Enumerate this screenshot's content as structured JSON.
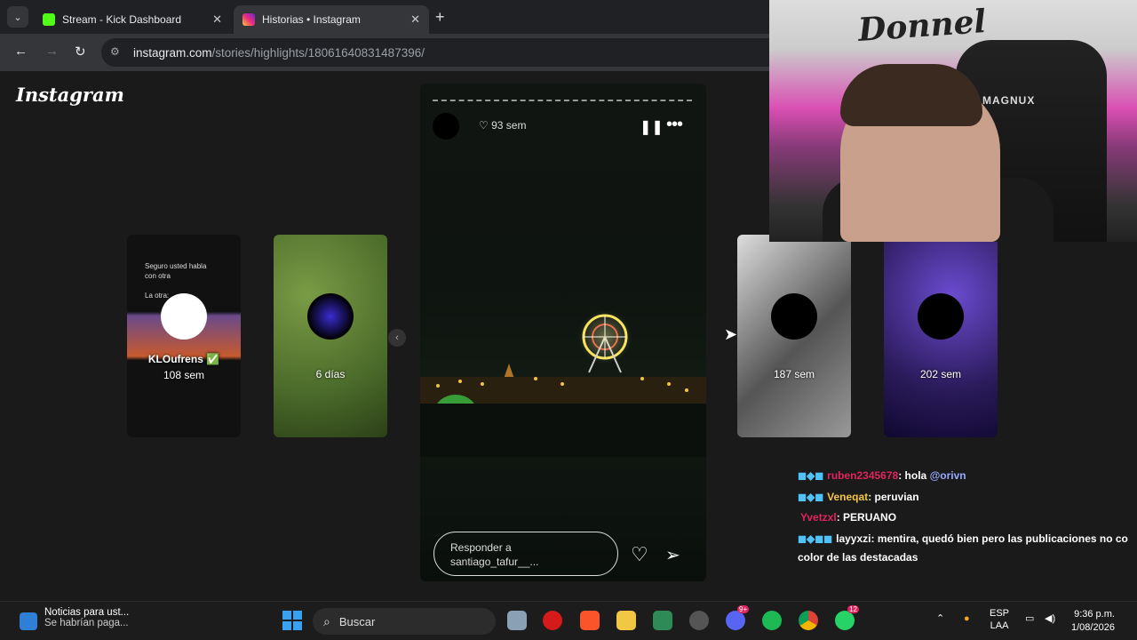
{
  "browser": {
    "tabs": [
      {
        "title": "Stream - Kick Dashboard",
        "favicon_color": "#53fc18",
        "active": false
      },
      {
        "title": "Historias • Instagram",
        "favicon_color": "#e1306c",
        "active": true
      }
    ],
    "new_tab": "+",
    "url_host": "instagram.com",
    "url_path": "/stories/highlights/18061640831487396/"
  },
  "instagram": {
    "logo": "Instagram",
    "side_stories": [
      {
        "name": "KLOufrens ✅",
        "age": "108 sem",
        "caption_1": "Seguro usted habla",
        "caption_2": "con otra",
        "caption_3": "La otra:"
      },
      {
        "name": "",
        "age": "6 días"
      },
      {
        "name": "",
        "age": "187 sem"
      },
      {
        "name": "",
        "age": "202 sem"
      }
    ],
    "story": {
      "time": "93 sem",
      "reply_placeholder": "Responder a santiago_tafur__..."
    }
  },
  "webcam": {
    "graffiti": "Donnel",
    "chair_brand": "MAGNUX"
  },
  "chat": [
    {
      "user": "ruben2345678",
      "user_color": "#e0245e",
      "message": ": hola ",
      "mention": "@orivn"
    },
    {
      "user": "Veneqat",
      "user_color": "#f5c542",
      "message": ": peruvian"
    },
    {
      "user": "Yvetzxl",
      "user_color": "#e0245e",
      "message": ": PERUANO"
    },
    {
      "user": "layyxzi",
      "user_color": "#ffffff",
      "message": ": mentira, quedó bien pero las publicaciones no co",
      "continuation": "color de las destacadas"
    }
  ],
  "taskbar": {
    "news_title": "Noticias para ust...",
    "news_sub": "Se habrían paga...",
    "search": "Buscar",
    "lang_1": "ESP",
    "lang_2": "LAA",
    "time": "9:36 p.m.",
    "date": "1/08/2026",
    "badge_discord": "9+",
    "badge_whatsapp": "12"
  }
}
